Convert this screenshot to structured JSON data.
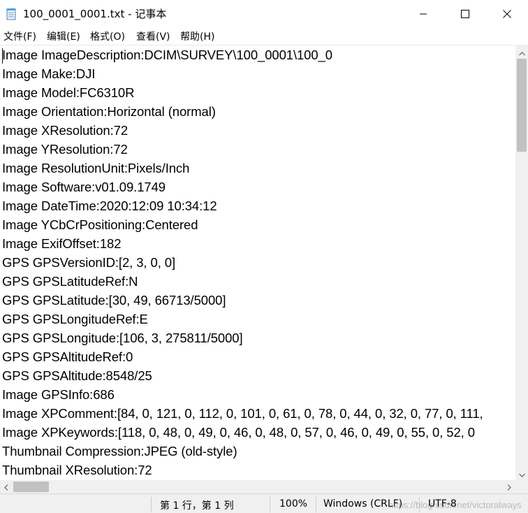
{
  "window": {
    "title": "100_0001_0001.txt - 记事本"
  },
  "menu": [
    {
      "label": "文件(F)"
    },
    {
      "label": "编辑(E)"
    },
    {
      "label": "格式(O)"
    },
    {
      "label": "查看(V)"
    },
    {
      "label": "帮助(H)"
    }
  ],
  "editor": {
    "lines": [
      "Image ImageDescription:DCIM\\SURVEY\\100_0001\\100_0",
      "Image Make:DJI",
      "Image Model:FC6310R",
      "Image Orientation:Horizontal (normal)",
      "Image XResolution:72",
      "Image YResolution:72",
      "Image ResolutionUnit:Pixels/Inch",
      "Image Software:v01.09.1749",
      "Image DateTime:2020:12:09 10:34:12",
      "Image YCbCrPositioning:Centered",
      "Image ExifOffset:182",
      "GPS GPSVersionID:[2, 3, 0, 0]",
      "GPS GPSLatitudeRef:N",
      "GPS GPSLatitude:[30, 49, 66713/5000]",
      "GPS GPSLongitudeRef:E",
      "GPS GPSLongitude:[106, 3, 275811/5000]",
      "GPS GPSAltitudeRef:0",
      "GPS GPSAltitude:8548/25",
      "Image GPSInfo:686",
      "Image XPComment:[84, 0, 121, 0, 112, 0, 101, 0, 61, 0, 78, 0, 44, 0, 32, 0, 77, 0, 111,",
      "Image XPKeywords:[118, 0, 48, 0, 49, 0, 46, 0, 48, 0, 57, 0, 46, 0, 49, 0, 55, 0, 52, 0",
      "Thumbnail Compression:JPEG (old-style)",
      "Thumbnail XResolution:72"
    ]
  },
  "status": {
    "position": "第 1 行，第 1 列",
    "zoom": "100%",
    "line_ending": "Windows (CRLF)",
    "encoding": "UTF-8",
    "watermark": "https://blog.csdn.net/victoralways"
  },
  "icons": {
    "app": "notepad-icon",
    "minimize": "minimize-icon",
    "maximize": "maximize-icon",
    "close": "close-icon",
    "scroll_up": "chevron-up-icon",
    "scroll_down": "chevron-down-icon",
    "scroll_left": "chevron-left-icon",
    "scroll_right": "chevron-right-icon"
  },
  "colors": {
    "chrome_bg": "#f0f0f0",
    "scroll_thumb": "#c1c1c1",
    "text": "#000000"
  }
}
